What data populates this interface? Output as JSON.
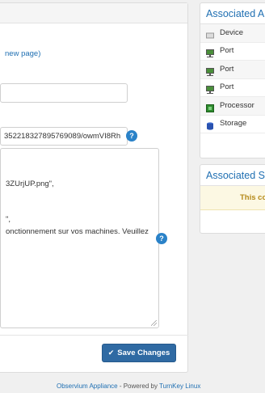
{
  "main": {
    "new_page_link": "new page)",
    "field2_value": "352218327895769089/owmVI8Rh",
    "textarea_lines": [
      "3ZUrjUP.png\",",
      "\",",
      "onctionnement sur vos machines. Veuillez"
    ],
    "help_icon_char": "?",
    "save_label": "Save Changes",
    "save_icon": "check-icon"
  },
  "footer": {
    "link1": "Observium Appliance",
    "sep": " - Powered by ",
    "link2": "TurnKey Linux"
  },
  "associated_a": {
    "title": "Associated Al",
    "items": [
      {
        "label": "Device",
        "icon": "device-icon"
      },
      {
        "label": "Port",
        "icon": "port-icon"
      },
      {
        "label": "Port",
        "icon": "port-icon"
      },
      {
        "label": "Port",
        "icon": "port-icon"
      },
      {
        "label": "Processor",
        "icon": "processor-icon"
      },
      {
        "label": "Storage",
        "icon": "storage-icon"
      }
    ]
  },
  "associated_s": {
    "title": "Associated Sy",
    "notice": "This co"
  }
}
